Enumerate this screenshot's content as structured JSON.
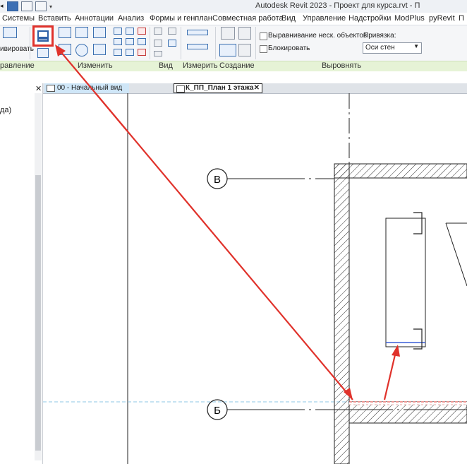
{
  "window": {
    "title": "Autodesk Revit 2023 - Проект для курса.rvt - П"
  },
  "menu": {
    "items": [
      "Системы",
      "Вставить",
      "Аннотации",
      "Анализ",
      "Формы и генплан",
      "Совместная работа",
      "Вид",
      "Управление",
      "Надстройки",
      "ModPlus",
      "pyRevit",
      "П"
    ]
  },
  "ribbon": {
    "partial_label": "ивировать",
    "panels": {
      "manage": "равление",
      "modify": "Изменить",
      "view": "Вид",
      "measure": "Измерить",
      "create": "Создание",
      "align": "Выровнять"
    },
    "options": {
      "multi_align": "Выравнивание неск. объектов",
      "lock": "Блокировать",
      "snap_label": "Привязка:",
      "snap_value": "Оси стен"
    }
  },
  "left_panel": {
    "fragment": "да)"
  },
  "tabs": [
    {
      "label": "00 - Начальный вид",
      "active": false
    },
    {
      "label": "К_ПП_План 1 этажа",
      "active": true
    }
  ],
  "drawing": {
    "grid_labels": [
      "В",
      "Б"
    ]
  },
  "colors": {
    "highlight": "#e0322b",
    "ribbon_strip": "#e6f3d6",
    "tab_inactive": "#cfe6f7",
    "reference_line": "#8ec7e6"
  }
}
